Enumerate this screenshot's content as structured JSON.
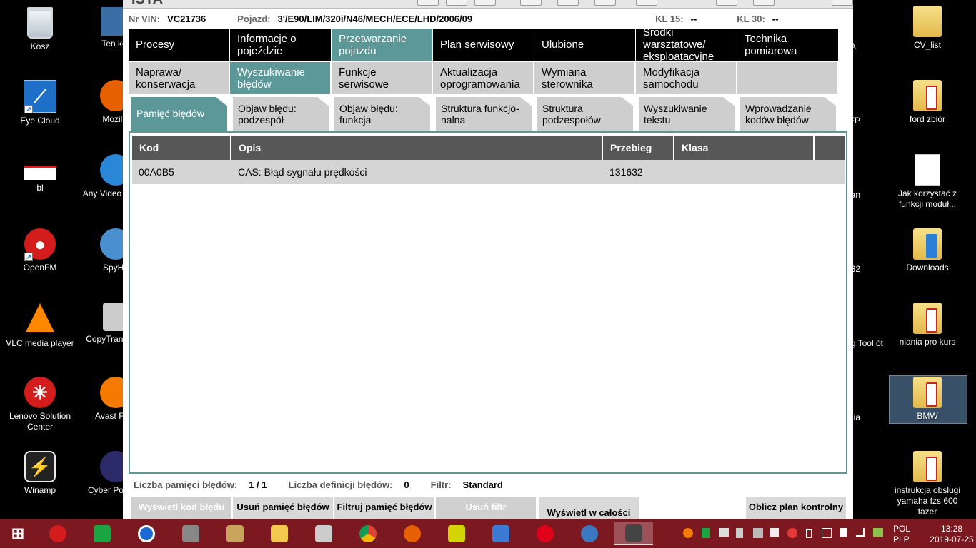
{
  "desktop_icons_left": [
    {
      "label": "Kosz",
      "icon": "recycle-bin-icon"
    },
    {
      "label": "Eye Cloud",
      "icon": "eye-cloud-icon"
    },
    {
      "label": "bl",
      "icon": "document-icon"
    },
    {
      "label": "OpenFM",
      "icon": "openfm-icon"
    },
    {
      "label": "VLC media player",
      "icon": "vlc-icon"
    },
    {
      "label": "Lenovo Solution Center",
      "icon": "lenovo-icon"
    },
    {
      "label": "Winamp",
      "icon": "winamp-icon"
    }
  ],
  "desktop_icons_left2": [
    {
      "label": "Ten kor"
    },
    {
      "label": "Mozilla"
    },
    {
      "label": "Any Video Profes"
    },
    {
      "label": "SpyHu"
    },
    {
      "label": "CopyTrans Cen"
    },
    {
      "label": "Avast Free"
    },
    {
      "label": "Cyber PowerD"
    }
  ],
  "desktop_icons_right": [
    {
      "label": "CV_list"
    },
    {
      "label": "ford zbiór"
    },
    {
      "label": "Jak korzystać z funkcji moduł..."
    },
    {
      "label": "Downloads"
    },
    {
      "label": "niania pro  kurs"
    },
    {
      "label": "BMW"
    },
    {
      "label": "instrukcja obslugi yamaha fzs 600 fazer"
    }
  ],
  "desktop_partial_right": [
    "A",
    "FP",
    "an",
    "32",
    "ng Tool ót",
    "ia"
  ],
  "window": {
    "app_title": "ISTA",
    "vin_label": "Nr VIN:",
    "vin": "VC21736",
    "vehicle_label": "Pojazd:",
    "vehicle": "3'/E90/LIM/320i/N46/MECH/ECE/LHD/2006/09",
    "kl15_label": "KL 15:",
    "kl15": "--",
    "kl30_label": "KL 30:",
    "kl30": "--"
  },
  "nav1": [
    {
      "label": "Procesy"
    },
    {
      "label": "Informacje o pojeździe"
    },
    {
      "label": "Przetwarzanie pojazdu",
      "active": true
    },
    {
      "label": "Plan serwisowy"
    },
    {
      "label": "Ulubione"
    },
    {
      "label": "Środki warsztatowe/ eksploatacyjne"
    },
    {
      "label": "Technika pomiarowa"
    }
  ],
  "nav2": [
    {
      "label": "Naprawa/ konserwacja"
    },
    {
      "label": "Wyszukiwanie błędów",
      "active": true
    },
    {
      "label": "Funkcje serwisowe"
    },
    {
      "label": "Aktualizacja oprogramowania"
    },
    {
      "label": "Wymiana sterownika"
    },
    {
      "label": "Modyfikacja samochodu"
    },
    {
      "label": ""
    }
  ],
  "nav3": [
    {
      "label": "Pamięć błędów",
      "active": true
    },
    {
      "label": "Objaw błędu: podzespół"
    },
    {
      "label": "Objaw błędu: funkcja"
    },
    {
      "label": "Struktura funkcjo- nalna"
    },
    {
      "label": "Struktura podzespołów"
    },
    {
      "label": "Wyszukiwanie tekstu"
    },
    {
      "label": "Wprowadzanie kodów błędów"
    }
  ],
  "table": {
    "headers": [
      "Kod",
      "Opis",
      "Przebieg",
      "Klasa",
      ""
    ],
    "rows": [
      [
        "00A0B5",
        "CAS: Błąd sygnału prędkości",
        "131632",
        "",
        ""
      ]
    ]
  },
  "status": {
    "count_label": "Liczba pamięci błędów:",
    "count": "1 / 1",
    "def_label": "Liczba definicji błędów:",
    "def": "0",
    "filter_label": "Filtr:",
    "filter": "Standard"
  },
  "buttons": [
    {
      "label": "Wyświetl kod błędu",
      "disabled": true
    },
    {
      "label": "Usuń pamięć błędów"
    },
    {
      "label": "Filtruj pamięć błędów"
    },
    {
      "label": "Usuń filtr",
      "disabled": true
    },
    {
      "label": "Wyświetl w całości"
    },
    {
      "label": "Oblicz plan kontrolny"
    }
  ],
  "taskbar": {
    "lang_top": "POL",
    "lang_bottom": "PLP",
    "time": "13:28",
    "date": "2019-07-25"
  },
  "colors": {
    "accent": "#5d9899",
    "taskbar": "#7b1820",
    "header_dark": "#575757"
  }
}
